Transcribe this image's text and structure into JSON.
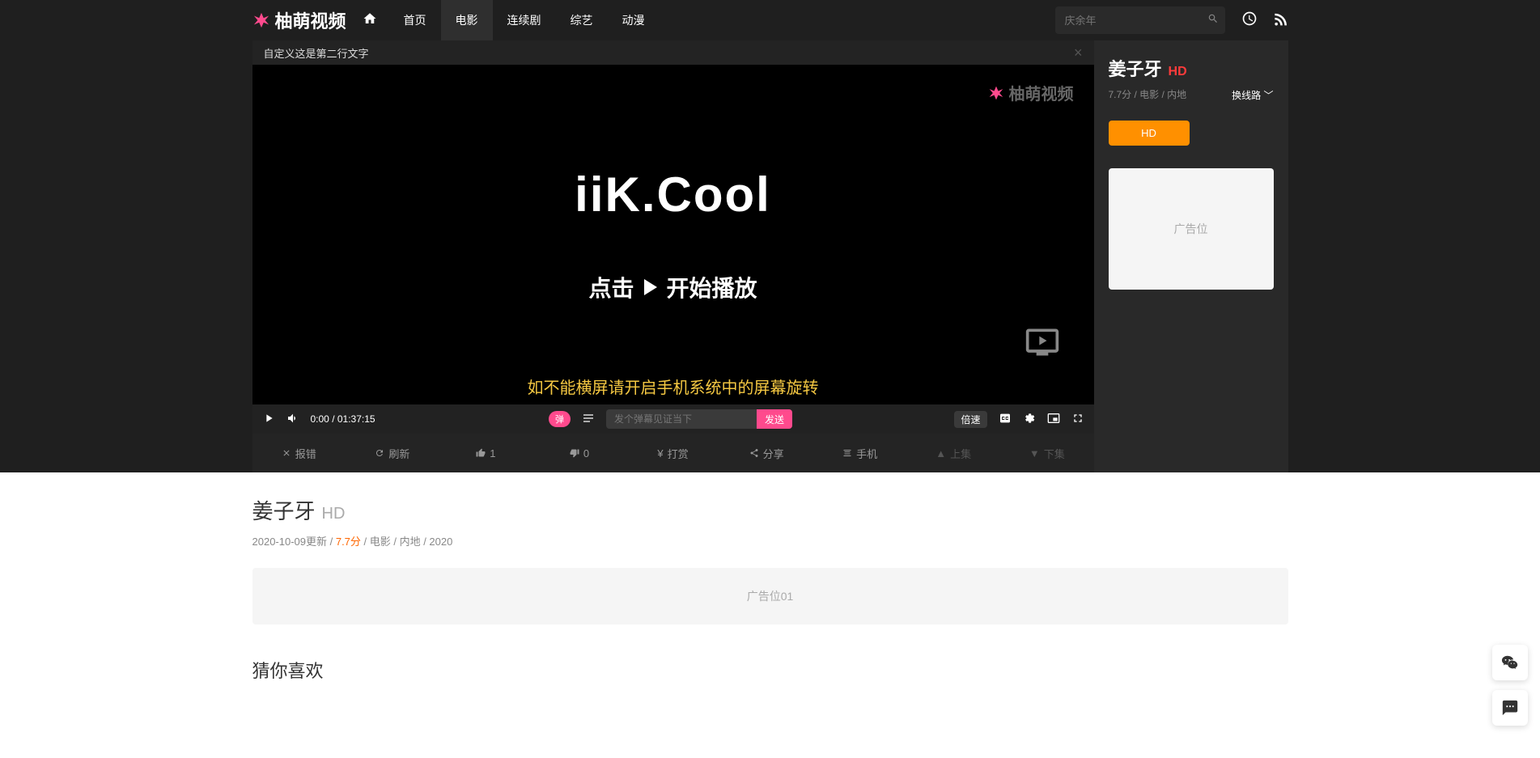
{
  "header": {
    "logo": "柚萌视频",
    "nav": [
      "首页",
      "电影",
      "连续剧",
      "综艺",
      "动漫"
    ],
    "active_index": 1,
    "search_placeholder": "庆余年"
  },
  "notice": {
    "text": "自定义这是第二行文字"
  },
  "player": {
    "watermark": "柚萌视频",
    "center_text": "iiK.Cool",
    "play_hint_before": "点击",
    "play_hint_after": "开始播放",
    "yellow_hint": "如不能横屏请开启手机系统中的屏幕旋转",
    "time": "0:00 / 01:37:15",
    "danmu_toggle": "弹",
    "danmu_placeholder": "发个弹幕见证当下",
    "send": "发送",
    "speed": "倍速"
  },
  "toolbar": {
    "report": "报错",
    "refresh": "刷新",
    "like": "1",
    "dislike": "0",
    "reward": "打赏",
    "share": "分享",
    "mobile": "手机",
    "prev": "上集",
    "next": "下集"
  },
  "side": {
    "title": "姜子牙",
    "quality": "HD",
    "meta": "7.7分 / 电影 / 内地",
    "route": "换线路",
    "episode": "HD",
    "ad": "广告位"
  },
  "info": {
    "title": "姜子牙",
    "quality": "HD",
    "meta_prefix": "2020-10-09更新 / ",
    "score": "7.7分",
    "meta_suffix": " / 电影 / 内地 / 2020",
    "ad": "广告位01",
    "rec": "猜你喜欢"
  }
}
